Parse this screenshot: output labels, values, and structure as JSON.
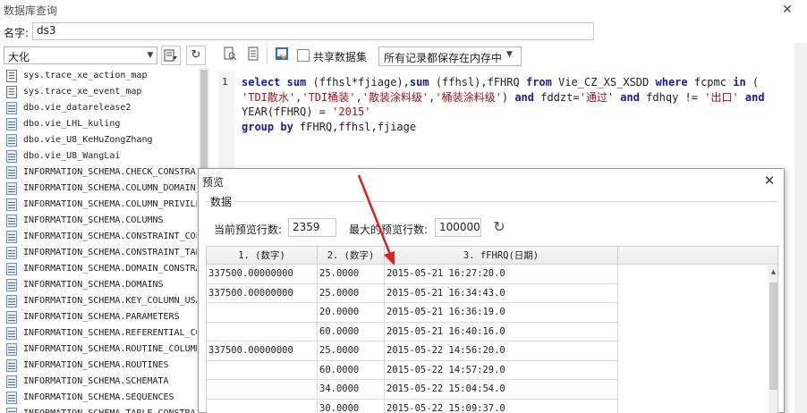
{
  "window": {
    "title": "数据库查询",
    "close": "✕"
  },
  "name_field": {
    "label": "名字:",
    "value": "ds3"
  },
  "left_panel": {
    "db_select": {
      "value": "大化"
    },
    "tree_items": [
      {
        "label": "sys.trace_xe_action_map",
        "icon": "system-table-icon"
      },
      {
        "label": "sys.trace_xe_event_map",
        "icon": "system-table-icon"
      },
      {
        "label": "dbo.vie_datarelease2",
        "icon": "view-icon"
      },
      {
        "label": "dbo.vie_LHL_kuling",
        "icon": "view-icon"
      },
      {
        "label": "dbo.vie_U8_KeHuZongZhang",
        "icon": "view-icon"
      },
      {
        "label": "dbo.vie_U8_WangLai",
        "icon": "view-icon"
      },
      {
        "label": "INFORMATION_SCHEMA.CHECK_CONSTRAINTS",
        "icon": "view-icon"
      },
      {
        "label": "INFORMATION_SCHEMA.COLUMN_DOMAIN_USAGE",
        "icon": "view-icon"
      },
      {
        "label": "INFORMATION_SCHEMA.COLUMN_PRIVILEGES",
        "icon": "view-icon"
      },
      {
        "label": "INFORMATION_SCHEMA.COLUMNS",
        "icon": "view-icon"
      },
      {
        "label": "INFORMATION_SCHEMA.CONSTRAINT_COLUMN_USAGE",
        "icon": "view-icon"
      },
      {
        "label": "INFORMATION_SCHEMA.CONSTRAINT_TABLE_USAGE",
        "icon": "view-icon"
      },
      {
        "label": "INFORMATION_SCHEMA.DOMAIN_CONSTRAINTS",
        "icon": "view-icon"
      },
      {
        "label": "INFORMATION_SCHEMA.DOMAINS",
        "icon": "view-icon"
      },
      {
        "label": "INFORMATION_SCHEMA.KEY_COLUMN_USAGE",
        "icon": "view-icon"
      },
      {
        "label": "INFORMATION_SCHEMA.PARAMETERS",
        "icon": "view-icon"
      },
      {
        "label": "INFORMATION_SCHEMA.REFERENTIAL_CONSTRAINTS",
        "icon": "view-icon"
      },
      {
        "label": "INFORMATION_SCHEMA.ROUTINE_COLUMNS",
        "icon": "view-icon"
      },
      {
        "label": "INFORMATION_SCHEMA.ROUTINES",
        "icon": "view-icon"
      },
      {
        "label": "INFORMATION_SCHEMA.SCHEMATA",
        "icon": "view-icon"
      },
      {
        "label": "INFORMATION_SCHEMA.SEQUENCES",
        "icon": "view-icon"
      },
      {
        "label": "INFORMATION_SCHEMA.TABLE_CONSTRAINTS",
        "icon": "view-icon"
      }
    ]
  },
  "toolbar": {
    "shared_dataset_label": "共享数据集",
    "memory_select_value": "所有记录都保存在内存中"
  },
  "editor": {
    "line_number": "1",
    "sql": {
      "l1_select": "select",
      "l1_sum1": "sum",
      "l1_arg1": "(ffhsl*fjiage),",
      "l1_sum2": "sum",
      "l1_arg2": "(ffhsl),fFHRQ",
      "l1_from": "from",
      "l1_table": "Vie_CZ_XS_XSDD",
      "l1_where": "where",
      "l1_col": "fcpmc",
      "l1_in": "in",
      "l1_paren": "(",
      "l2_s1": "'TDI散水'",
      "l2_s2": "'TDI桶装'",
      "l2_s3": "'散装涂料级'",
      "l2_s4": "'桶装涂料级'",
      "l2_rest1": ") ",
      "l2_and1": "and",
      "l2_fddzt": "fddzt=",
      "l2_s5": "'通过'",
      "l2_and2": "and",
      "l2_fdhqy": "fdhqy != ",
      "l2_s6": "'出口'",
      "l2_and3": "and",
      "l3_year": "YEAR(fFHRQ) = ",
      "l3_s": "'2015'",
      "l4_group": "group",
      "l4_by": "by",
      "l4_rest": "fFHRQ,ffhsl,fjiage"
    }
  },
  "preview": {
    "title": "预览",
    "group_label": "数据",
    "current_rows_label": "当前预览行数:",
    "current_rows_value": "2359",
    "max_rows_label": "最大的预览行数:",
    "max_rows_value": "100000",
    "columns": [
      "1. (数字)",
      "2. (数字)",
      "3. fFHRQ(日期)"
    ],
    "rows": [
      [
        "337500.00000000",
        "25.0000",
        "2015-05-21 16:27:20.0"
      ],
      [
        "337500.00000000",
        "25.0000",
        "2015-05-21 16:34:43.0"
      ],
      [
        "",
        "20.0000",
        "2015-05-21 16:36:19.0"
      ],
      [
        "",
        "60.0000",
        "2015-05-21 16:40:16.0"
      ],
      [
        "337500.00000000",
        "25.0000",
        "2015-05-22 14:56:20.0"
      ],
      [
        "",
        "60.0000",
        "2015-05-22 14:57:29.0"
      ],
      [
        "",
        "34.0000",
        "2015-05-22 15:04:54.0"
      ],
      [
        "",
        "30.0000",
        "2015-05-22 15:09:37.0"
      ]
    ]
  },
  "colors": {
    "keyword": "#1a1aa6",
    "string": "#a31515",
    "annotation_arrow": "#e02020"
  }
}
